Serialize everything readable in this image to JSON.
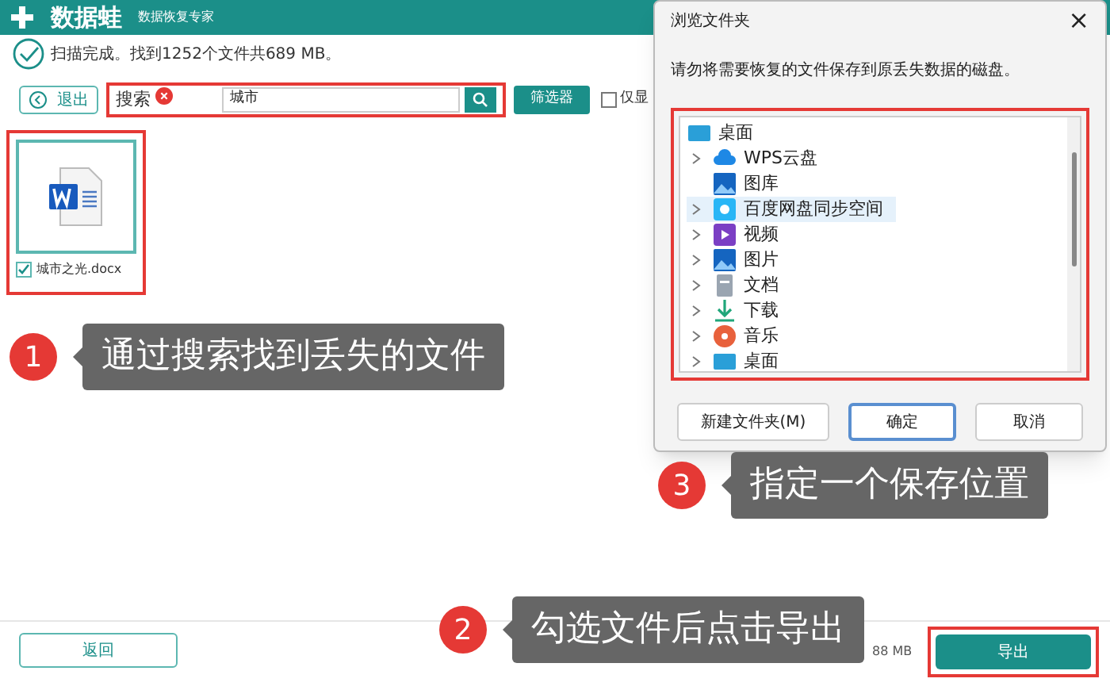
{
  "app": {
    "logo": "数据蛙",
    "tagline": "数据恢复专家",
    "status": "扫描完成。找到1252个文件共689 MB。"
  },
  "toolbar": {
    "exit": "退出",
    "search_label": "搜索",
    "search_value": "城市",
    "filter": "筛选器",
    "only_show": {
      "label": "仅显",
      "checked": false
    }
  },
  "files": [
    {
      "name": "城市之光.docx",
      "checked": true
    }
  ],
  "footer": {
    "back": "返回",
    "selection_summary": "88 MB",
    "export": "导出"
  },
  "dialog": {
    "title": "浏览文件夹",
    "close": "×",
    "message": "请勿将需要恢复的文件保存到原丢失数据的磁盘。",
    "tree": [
      {
        "kind": "desktop",
        "label": "桌面",
        "selected": false,
        "children": [
          {
            "kind": "cloud",
            "label": "WPS云盘",
            "expandable": true,
            "selected": false
          },
          {
            "kind": "gallery",
            "label": "图库",
            "expandable": false,
            "selected": false
          },
          {
            "kind": "sync",
            "label": "百度网盘同步空间",
            "expandable": true,
            "selected": true
          },
          {
            "kind": "video",
            "label": "视频",
            "expandable": true,
            "selected": false
          },
          {
            "kind": "pictures",
            "label": "图片",
            "expandable": true,
            "selected": false
          },
          {
            "kind": "docs",
            "label": "文档",
            "expandable": true,
            "selected": false
          },
          {
            "kind": "download",
            "label": "下载",
            "expandable": true,
            "selected": false
          },
          {
            "kind": "music",
            "label": "音乐",
            "expandable": true,
            "selected": false
          },
          {
            "kind": "desktop",
            "label": "桌面",
            "expandable": true,
            "selected": false
          }
        ]
      }
    ],
    "buttons": [
      {
        "label": "新建文件夹(M)",
        "default": false
      },
      {
        "label": "确定",
        "default": true
      },
      {
        "label": "取消",
        "default": false
      }
    ]
  },
  "callouts": [
    {
      "number": "1",
      "text": "通过搜索找到丢失的文件"
    },
    {
      "number": "2",
      "text": "勾选文件后点击导出"
    },
    {
      "number": "3",
      "text": "指定一个保存位置"
    }
  ]
}
